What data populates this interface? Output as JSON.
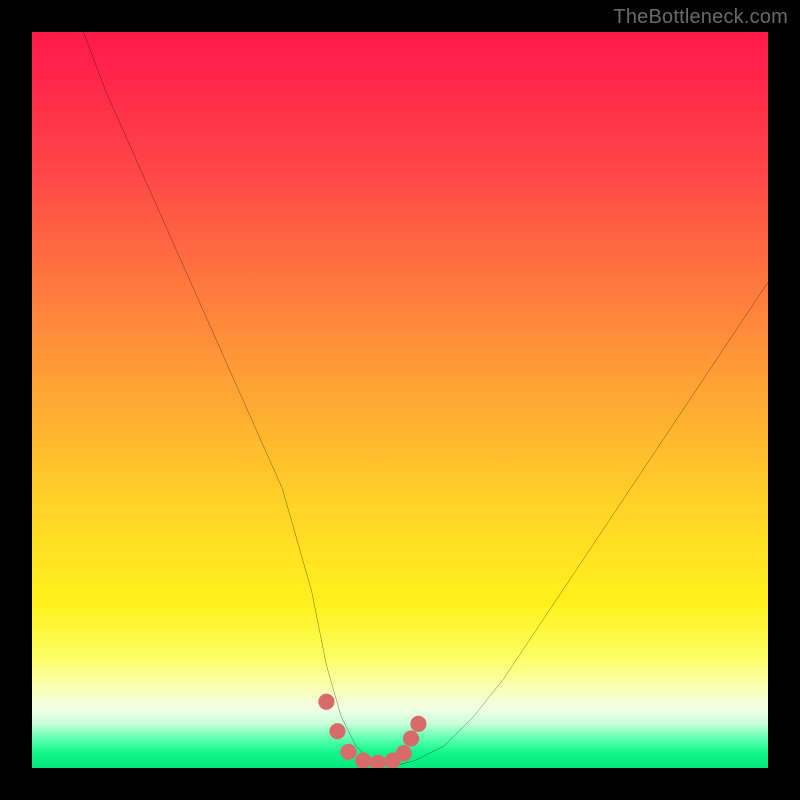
{
  "watermark": "TheBottleneck.com",
  "chart_data": {
    "type": "line",
    "title": "",
    "xlabel": "",
    "ylabel": "",
    "xlim": [
      0,
      100
    ],
    "ylim": [
      0,
      100
    ],
    "series": [
      {
        "name": "v-curve",
        "x": [
          7,
          10,
          14,
          18,
          22,
          26,
          30,
          34,
          38,
          40,
          42,
          44,
          46,
          48,
          50,
          52,
          56,
          60,
          64,
          68,
          72,
          76,
          80,
          84,
          88,
          92,
          96,
          100
        ],
        "y": [
          100,
          92,
          83,
          74,
          65,
          56,
          47,
          38,
          24,
          14,
          7,
          3,
          1,
          0.5,
          0.5,
          1,
          3,
          7,
          12,
          18,
          24,
          30,
          36,
          42,
          48,
          54,
          60,
          66
        ]
      }
    ],
    "markers": {
      "name": "highlight-dots",
      "color": "#d96a6a",
      "x": [
        40,
        41.5,
        43,
        45,
        47,
        49,
        50.5,
        51.5,
        52.5
      ],
      "y": [
        9,
        5,
        2.2,
        1,
        0.7,
        1,
        2,
        4,
        6
      ]
    },
    "background_gradient": {
      "top": "#ff1a4a",
      "upper_mid": "#ffa833",
      "lower_mid": "#fff21c",
      "bottom": "#06e87e"
    }
  }
}
